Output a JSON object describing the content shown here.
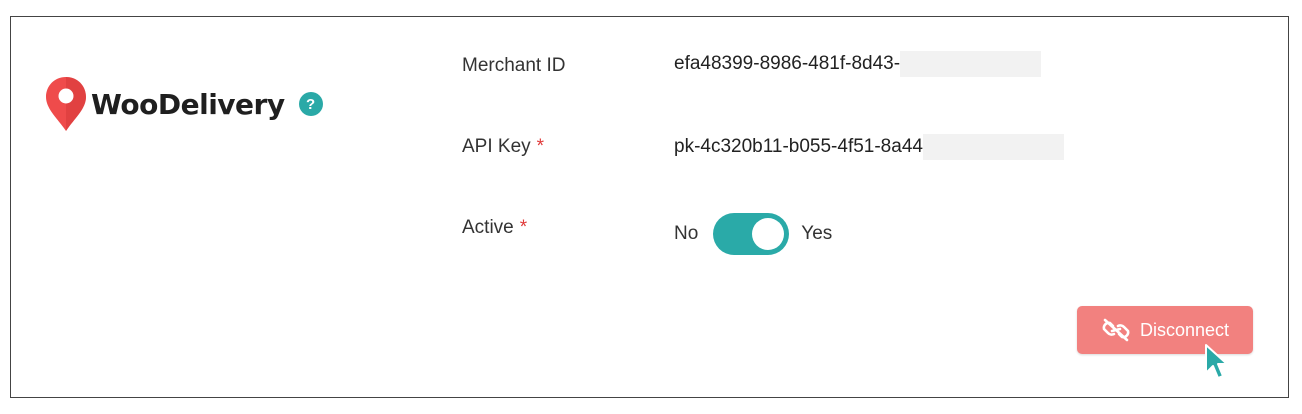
{
  "brand": {
    "name": "WooDelivery",
    "help_icon": "question-circle-icon",
    "help_glyph": "?",
    "pin_icon": "map-pin-icon"
  },
  "fields": {
    "merchant_id": {
      "label": "Merchant ID",
      "value": "efa48399-8986-481f-8d43-"
    },
    "api_key": {
      "label": "API Key",
      "required_mark": "*",
      "value": "pk-4c320b11-b055-4f51-8a44"
    },
    "active": {
      "label": "Active",
      "required_mark": "*",
      "off_label": "No",
      "on_label": "Yes",
      "checked": true
    }
  },
  "actions": {
    "disconnect_label": "Disconnect",
    "disconnect_icon": "unlink-icon"
  },
  "colors": {
    "accent": "#2aa9a7",
    "danger_button": "#f2817f",
    "required": "#e03a3a",
    "pin": "#ef4b4b"
  }
}
